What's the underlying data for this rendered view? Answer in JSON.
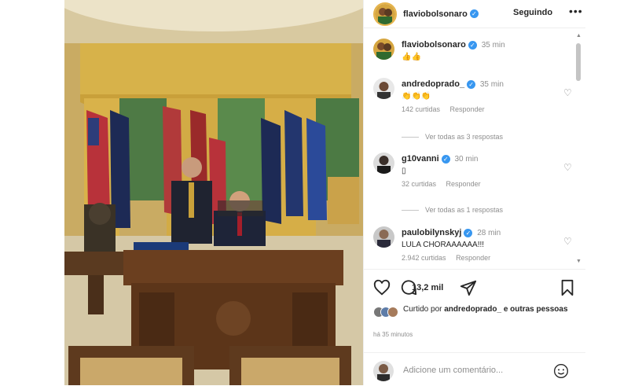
{
  "post": {
    "author": "flaviobolsonaro",
    "follow_label": "Seguindo",
    "more": "•••"
  },
  "caption": {
    "user": "flaviobolsonaro",
    "time": "35 min",
    "text": "👍👍"
  },
  "comments": [
    {
      "user": "andredoprado_",
      "time": "35 min",
      "text": "👏👏👏",
      "likes": "142 curtidas",
      "reply": "Responder",
      "view_replies": "Ver todas as 3 respostas"
    },
    {
      "user": "g10vanni",
      "time": "30 min",
      "text": "▯",
      "likes": "32 curtidas",
      "reply": "Responder",
      "view_replies": "Ver todas as 1 respostas"
    },
    {
      "user": "paulobilynskyj",
      "time": "28 min",
      "text": "LULA CHORAAAAAA!!!",
      "likes": "2.942 curtidas",
      "reply": "Responder"
    }
  ],
  "actions": {
    "comment_count": "13,2 mil",
    "icons": [
      "heart-icon",
      "comment-icon",
      "share-icon",
      "bookmark-icon"
    ]
  },
  "liked_by": {
    "prefix": "Curtido por ",
    "user": "andredoprado_",
    "suffix": " e outras pessoas"
  },
  "posted_ago": "há 35 minutos",
  "add_comment": {
    "placeholder": "Adicione um comentário..."
  },
  "colors": {
    "verified": "#3897f0",
    "secondary_text": "#8e8e8e",
    "text": "#262626"
  }
}
